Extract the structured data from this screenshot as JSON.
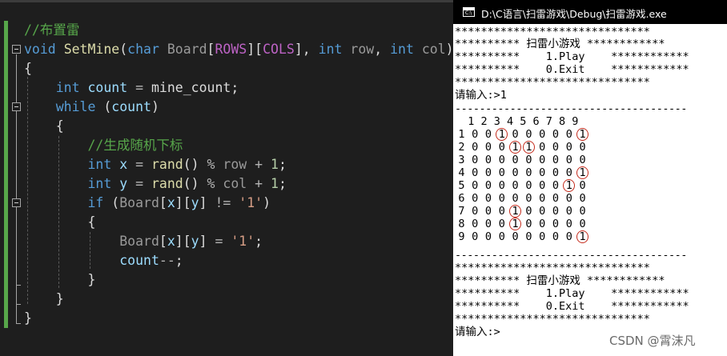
{
  "editor": {
    "lines": [
      [
        {
          "t": "//布置雷",
          "c": "cm"
        }
      ],
      [
        {
          "t": "void",
          "c": "kw"
        },
        {
          "t": " ",
          "c": "pl"
        },
        {
          "t": "SetMine",
          "c": "fn"
        },
        {
          "t": "(",
          "c": "pl"
        },
        {
          "t": "char",
          "c": "kw"
        },
        {
          "t": " ",
          "c": "pl"
        },
        {
          "t": "Board",
          "c": "pa"
        },
        {
          "t": "[",
          "c": "pl"
        },
        {
          "t": "ROWS",
          "c": "mc"
        },
        {
          "t": "][",
          "c": "pl"
        },
        {
          "t": "COLS",
          "c": "mc"
        },
        {
          "t": "], ",
          "c": "pl"
        },
        {
          "t": "int",
          "c": "kw"
        },
        {
          "t": " ",
          "c": "pl"
        },
        {
          "t": "row",
          "c": "pa"
        },
        {
          "t": ", ",
          "c": "pl"
        },
        {
          "t": "int",
          "c": "kw"
        },
        {
          "t": " ",
          "c": "pl"
        },
        {
          "t": "col",
          "c": "pa"
        },
        {
          "t": ")",
          "c": "pl"
        }
      ],
      [
        {
          "t": "{",
          "c": "pl"
        }
      ],
      [
        {
          "t": "    ",
          "c": "pl"
        },
        {
          "t": "int",
          "c": "kw"
        },
        {
          "t": " ",
          "c": "pl"
        },
        {
          "t": "count",
          "c": "lv"
        },
        {
          "t": " = ",
          "c": "op"
        },
        {
          "t": "mine_count",
          "c": "pl"
        },
        {
          "t": ";",
          "c": "pl"
        }
      ],
      [
        {
          "t": "    ",
          "c": "pl"
        },
        {
          "t": "while",
          "c": "kw"
        },
        {
          "t": " (",
          "c": "pl"
        },
        {
          "t": "count",
          "c": "lv"
        },
        {
          "t": ")",
          "c": "pl"
        }
      ],
      [
        {
          "t": "    ",
          "c": "pl"
        },
        {
          "t": "{",
          "c": "pl"
        }
      ],
      [
        {
          "t": "        ",
          "c": "pl"
        },
        {
          "t": "//生成随机下标",
          "c": "cm"
        }
      ],
      [
        {
          "t": "        ",
          "c": "pl"
        },
        {
          "t": "int",
          "c": "kw"
        },
        {
          "t": " ",
          "c": "pl"
        },
        {
          "t": "x",
          "c": "lv"
        },
        {
          "t": " = ",
          "c": "op"
        },
        {
          "t": "rand",
          "c": "fn"
        },
        {
          "t": "() ",
          "c": "pl"
        },
        {
          "t": "%",
          "c": "op"
        },
        {
          "t": " ",
          "c": "pl"
        },
        {
          "t": "row",
          "c": "pa"
        },
        {
          "t": " + ",
          "c": "op"
        },
        {
          "t": "1",
          "c": "nm"
        },
        {
          "t": ";",
          "c": "pl"
        }
      ],
      [
        {
          "t": "        ",
          "c": "pl"
        },
        {
          "t": "int",
          "c": "kw"
        },
        {
          "t": " ",
          "c": "pl"
        },
        {
          "t": "y",
          "c": "lv"
        },
        {
          "t": " = ",
          "c": "op"
        },
        {
          "t": "rand",
          "c": "fn"
        },
        {
          "t": "() ",
          "c": "pl"
        },
        {
          "t": "%",
          "c": "op"
        },
        {
          "t": " ",
          "c": "pl"
        },
        {
          "t": "col",
          "c": "pa"
        },
        {
          "t": " + ",
          "c": "op"
        },
        {
          "t": "1",
          "c": "nm"
        },
        {
          "t": ";",
          "c": "pl"
        }
      ],
      [
        {
          "t": "        ",
          "c": "pl"
        },
        {
          "t": "if",
          "c": "kw"
        },
        {
          "t": " (",
          "c": "pl"
        },
        {
          "t": "Board",
          "c": "pa"
        },
        {
          "t": "[",
          "c": "pl"
        },
        {
          "t": "x",
          "c": "lv"
        },
        {
          "t": "][",
          "c": "pl"
        },
        {
          "t": "y",
          "c": "lv"
        },
        {
          "t": "] ",
          "c": "pl"
        },
        {
          "t": "!=",
          "c": "op"
        },
        {
          "t": " ",
          "c": "pl"
        },
        {
          "t": "'1'",
          "c": "st"
        },
        {
          "t": ")",
          "c": "pl"
        }
      ],
      [
        {
          "t": "        ",
          "c": "pl"
        },
        {
          "t": "{",
          "c": "pl"
        }
      ],
      [
        {
          "t": "            ",
          "c": "pl"
        },
        {
          "t": "Board",
          "c": "pa"
        },
        {
          "t": "[",
          "c": "pl"
        },
        {
          "t": "x",
          "c": "lv"
        },
        {
          "t": "][",
          "c": "pl"
        },
        {
          "t": "y",
          "c": "lv"
        },
        {
          "t": "]",
          "c": "pl"
        },
        {
          "t": " = ",
          "c": "op"
        },
        {
          "t": "'1'",
          "c": "st"
        },
        {
          "t": ";",
          "c": "pl"
        }
      ],
      [
        {
          "t": "            ",
          "c": "pl"
        },
        {
          "t": "count",
          "c": "lv"
        },
        {
          "t": "--",
          "c": "op"
        },
        {
          "t": ";",
          "c": "pl"
        }
      ],
      [
        {
          "t": "        ",
          "c": "pl"
        },
        {
          "t": "}",
          "c": "pl"
        }
      ],
      [
        {
          "t": "    ",
          "c": "pl"
        },
        {
          "t": "}",
          "c": "pl"
        }
      ],
      [
        {
          "t": "}",
          "c": "pl"
        }
      ]
    ]
  },
  "console": {
    "title": "D:\\C语言\\扫雷游戏\\Debug\\扫雷游戏.exe",
    "icon_label": "C:\\",
    "menu_top": [
      "******************************",
      "********** 扫雷小游戏 ************",
      "**********    1.Play    ************",
      "**********    0.Exit    ************",
      "******************************",
      "请输入:>1"
    ],
    "divider": "--------------------------------------",
    "header_row": "  1 2 3 4 5 6 7 8 9",
    "grid": [
      {
        "label": "1",
        "cells": [
          "0",
          "0",
          "1",
          "0",
          "0",
          "0",
          "0",
          "0",
          "1"
        ]
      },
      {
        "label": "2",
        "cells": [
          "0",
          "0",
          "0",
          "1",
          "1",
          "0",
          "0",
          "0",
          "0"
        ]
      },
      {
        "label": "3",
        "cells": [
          "0",
          "0",
          "0",
          "0",
          "0",
          "0",
          "0",
          "0",
          "0"
        ]
      },
      {
        "label": "4",
        "cells": [
          "0",
          "0",
          "0",
          "0",
          "0",
          "0",
          "0",
          "0",
          "1"
        ]
      },
      {
        "label": "5",
        "cells": [
          "0",
          "0",
          "0",
          "0",
          "0",
          "0",
          "0",
          "1",
          "0"
        ]
      },
      {
        "label": "6",
        "cells": [
          "0",
          "0",
          "0",
          "0",
          "0",
          "0",
          "0",
          "0",
          "0"
        ]
      },
      {
        "label": "7",
        "cells": [
          "0",
          "0",
          "0",
          "1",
          "0",
          "0",
          "0",
          "0",
          "0"
        ]
      },
      {
        "label": "8",
        "cells": [
          "0",
          "0",
          "0",
          "1",
          "0",
          "0",
          "0",
          "0",
          "0"
        ]
      },
      {
        "label": "9",
        "cells": [
          "0",
          "0",
          "0",
          "0",
          "0",
          "0",
          "0",
          "0",
          "1"
        ]
      }
    ],
    "row5_tail": "1",
    "row9_tail": "0",
    "menu_bottom": [
      "******************************",
      "********** 扫雷小游戏 ************",
      "**********    1.Play    ************",
      "**********    0.Exit    ************",
      "******************************",
      "请输入:>"
    ]
  },
  "watermark": "CSDN @霄沫凡",
  "colors": {
    "editor_bg": "#1e1e1e",
    "comment": "#57a64a",
    "keyword": "#569cd6",
    "function": "#dcdcaa",
    "macro": "#bd63c5",
    "circle": "#c42b1c"
  }
}
